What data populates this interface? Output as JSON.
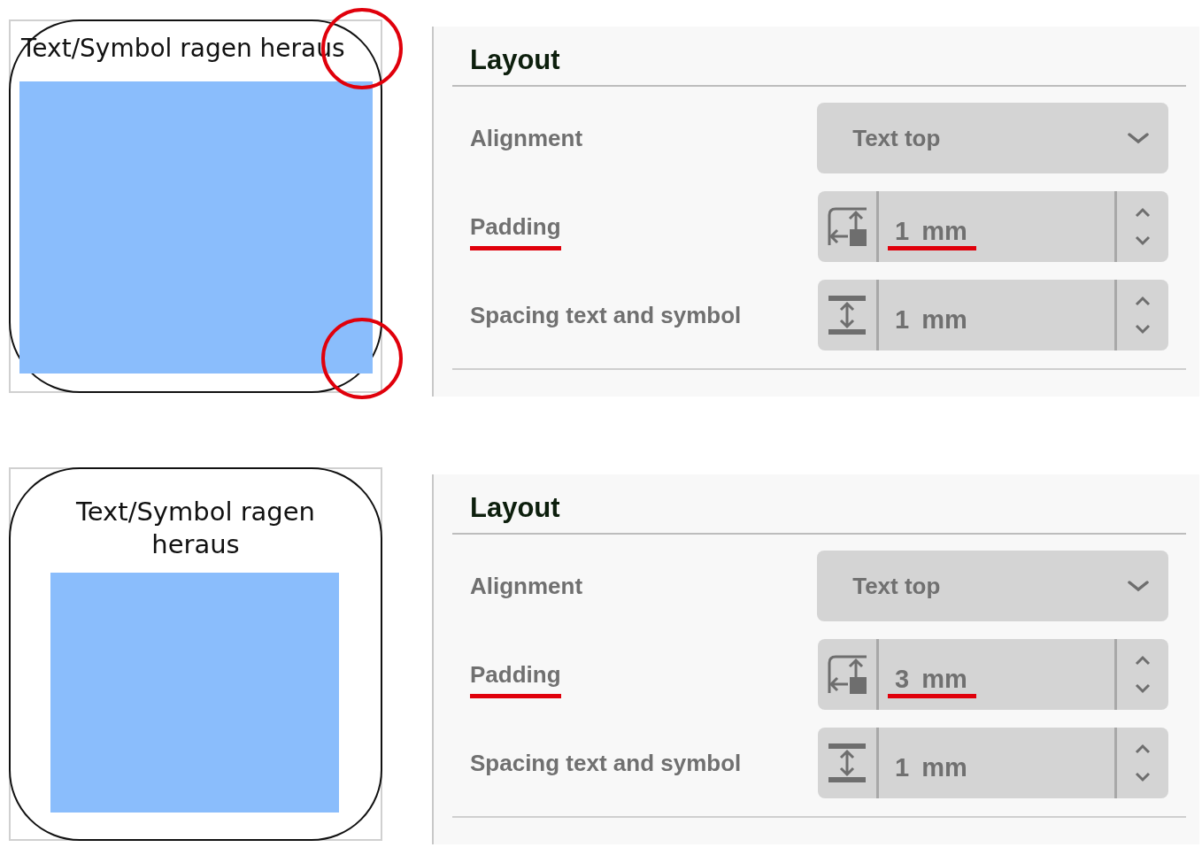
{
  "examples": [
    {
      "preview": {
        "label": "Text/Symbol ragen heraus",
        "overflow": true
      },
      "panel": {
        "title": "Layout",
        "rows": [
          {
            "kind": "dropdown",
            "label": "Alignment",
            "value": "Text top",
            "highlighted": false
          },
          {
            "kind": "padding",
            "label": "Padding",
            "value": "1",
            "unit": "mm",
            "highlighted": true
          },
          {
            "kind": "spacing",
            "label": "Spacing text and symbol",
            "value": "1",
            "unit": "mm",
            "highlighted": false
          }
        ]
      }
    },
    {
      "preview": {
        "label": "Text/Symbol ragen heraus",
        "overflow": false
      },
      "panel": {
        "title": "Layout",
        "rows": [
          {
            "kind": "dropdown",
            "label": "Alignment",
            "value": "Text top",
            "highlighted": false
          },
          {
            "kind": "padding",
            "label": "Padding",
            "value": "3",
            "unit": "mm",
            "highlighted": true
          },
          {
            "kind": "spacing",
            "label": "Spacing text and symbol",
            "value": "1",
            "unit": "mm",
            "highlighted": false
          }
        ]
      }
    }
  ]
}
